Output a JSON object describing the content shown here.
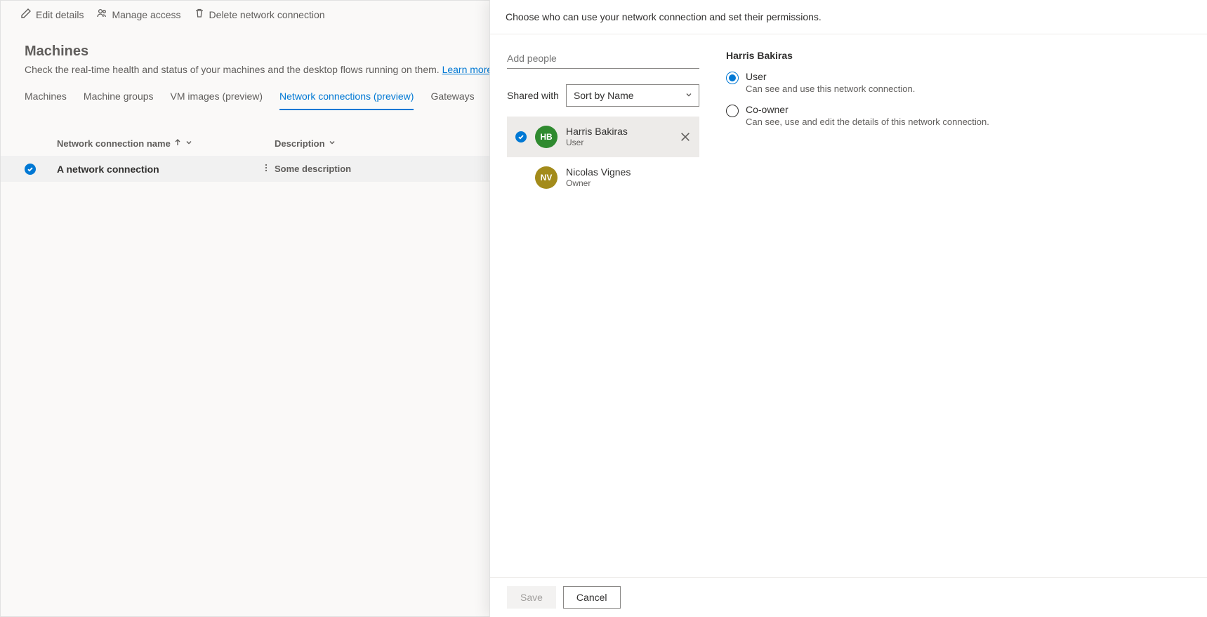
{
  "toolbar": {
    "edit_label": "Edit details",
    "manage_label": "Manage access",
    "delete_label": "Delete network connection"
  },
  "page": {
    "title": "Machines",
    "subtitle_text": "Check the real-time health and status of your machines and the desktop flows running on them. ",
    "learn_more": "Learn more"
  },
  "tabs": {
    "machines": "Machines",
    "groups": "Machine groups",
    "vm": "VM images (preview)",
    "network": "Network connections (preview)",
    "gateways": "Gateways"
  },
  "table": {
    "col_name": "Network connection name",
    "col_desc": "Description",
    "rows": [
      {
        "name": "A network connection",
        "desc": "Some description"
      }
    ]
  },
  "panel": {
    "instruction": "Choose who can use your network connection and set their permissions.",
    "add_placeholder": "Add people",
    "shared_label": "Shared with",
    "sort_value": "Sort by Name",
    "people": [
      {
        "initials": "HB",
        "name": "Harris Bakiras",
        "role": "User",
        "color": "green",
        "selected": true,
        "removable": true
      },
      {
        "initials": "NV",
        "name": "Nicolas Vignes",
        "role": "Owner",
        "color": "olive",
        "selected": false,
        "removable": false
      }
    ],
    "detail": {
      "name": "Harris Bakiras",
      "options": [
        {
          "label": "User",
          "desc": "Can see and use this network connection.",
          "checked": true
        },
        {
          "label": "Co-owner",
          "desc": "Can see, use and edit the details of this network connection.",
          "checked": false
        }
      ]
    },
    "save_label": "Save",
    "cancel_label": "Cancel"
  }
}
